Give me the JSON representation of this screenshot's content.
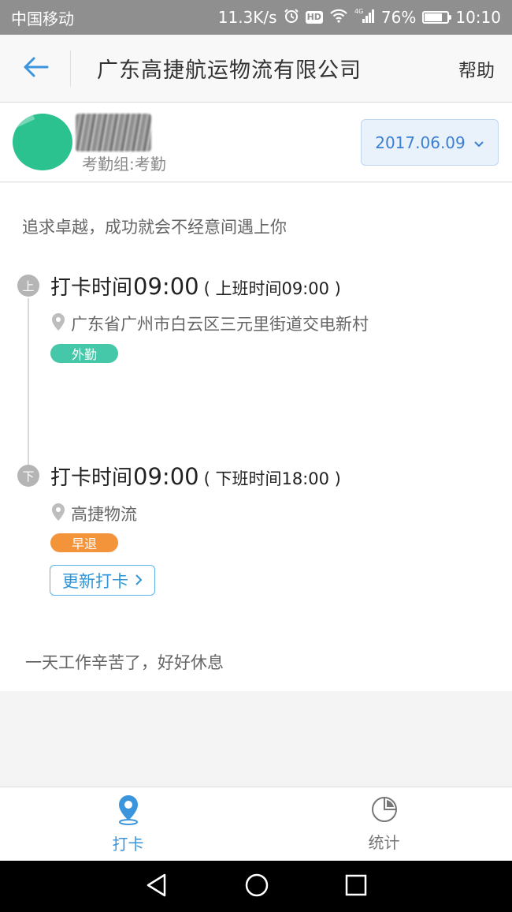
{
  "status_bar": {
    "carrier": "中国移动",
    "network_speed": "11.3K/s",
    "network_type": "4G",
    "battery_text": "76%",
    "battery_level": 0.76,
    "time": "10:10"
  },
  "header": {
    "title": "广东高捷航运物流有限公司",
    "help_label": "帮助"
  },
  "user": {
    "group_label": "考勤组:考勤",
    "date_label": "2017.06.09"
  },
  "main": {
    "motto": "追求卓越，成功就会不经意间遇上你",
    "records": [
      {
        "dot_label": "上",
        "punch_label": "打卡时间",
        "punch_time": "09:00",
        "schedule": "( 上班时间09:00 )",
        "location": "广东省广州市白云区三元里街道交电新村",
        "tag": "外勤"
      },
      {
        "dot_label": "下",
        "punch_label": "打卡时间",
        "punch_time": "09:00",
        "schedule": "( 下班时间18:00 )",
        "location": "高捷物流",
        "tag": "早退"
      }
    ],
    "update_button": "更新打卡",
    "farewell": "一天工作辛苦了，好好休息"
  },
  "tabbar": {
    "tabs": [
      {
        "label": "打卡",
        "icon": "location-pin-icon",
        "active": true
      },
      {
        "label": "统计",
        "icon": "pie-chart-icon",
        "active": false
      }
    ]
  },
  "colors": {
    "accent": "#3a95dc",
    "tag_out": "#45c7a9",
    "tag_early": "#f4943a",
    "avatar": "#2cc28f"
  }
}
